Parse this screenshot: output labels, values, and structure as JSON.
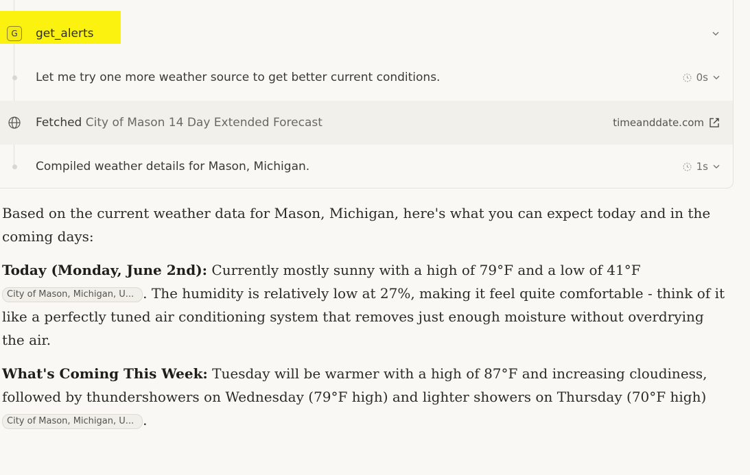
{
  "tool_panel": {
    "alerts_row": {
      "badge": "G",
      "label": "get_alerts",
      "chevron_icon": "chevron-down-icon"
    },
    "try_row": {
      "text": "Let me try one more weather source to get better current conditions.",
      "duration": "0s"
    },
    "fetch_row": {
      "prefix": "Fetched",
      "title": "City of Mason 14 Day Extended Forecast",
      "source": "timeanddate.com"
    },
    "compiled_row": {
      "text": "Compiled weather details for Mason, Michigan.",
      "duration": "1s"
    }
  },
  "response": {
    "intro": "Based on the current weather data for Mason, Michigan, here's what you can expect today and in the coming days:",
    "today": {
      "heading": "Today (Monday, June 2nd):",
      "text_before_cite": " Currently mostly sunny with a high of 79°F and a low of 41°F ",
      "citation": "City of Mason, Michigan, U...",
      "text_after_cite": ". The humidity is relatively low at 27%, making it feel quite comfortable - think of it like a perfectly tuned air conditioning system that removes just enough moisture without overdrying the air."
    },
    "week": {
      "heading": "What's Coming This Week:",
      "text_before_cite": " Tuesday will be warmer with a high of 87°F and increasing cloudiness, followed by thundershowers on Wednesday (79°F high) and lighter showers on Thursday (70°F high) ",
      "citation": "City of Mason, Michigan, U...",
      "text_after_cite": "."
    }
  },
  "colors": {
    "highlight": "#fbf30f",
    "background": "#f9f8f4",
    "row_hover": "#f1f0eb"
  }
}
